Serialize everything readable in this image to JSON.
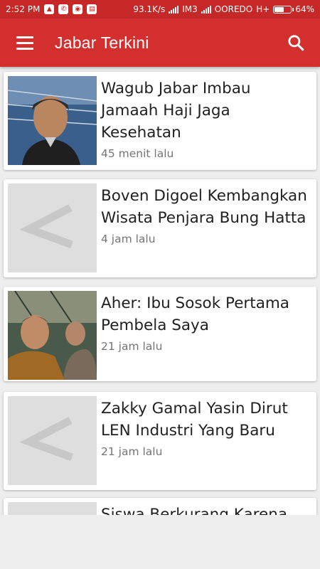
{
  "status_bar": {
    "time": "2:52 PM",
    "speed": "93.1K/s",
    "carrier1": "IM3",
    "carrier2": "OOREDO",
    "network": "H+",
    "battery": "64%",
    "battery_level": 0.64
  },
  "app_bar": {
    "title": "Jabar Terkini",
    "menu_icon": "hamburger-menu-icon",
    "search_icon": "search-icon"
  },
  "articles": [
    {
      "title": "Wagub Jabar Imbau Jamaah Haji Jaga Kesehatan",
      "time": "45 menit lalu",
      "thumbnail": "photo"
    },
    {
      "title": "Boven Digoel Kembangkan Wisata Penjara Bung Hatta",
      "time": "4 jam lalu",
      "thumbnail": "placeholder"
    },
    {
      "title": "Aher: Ibu Sosok Pertama Pembela Saya",
      "time": "21 jam lalu",
      "thumbnail": "photo"
    },
    {
      "title": "Zakky Gamal Yasin Dirut LEN Industri Yang Baru",
      "time": "21 jam lalu",
      "thumbnail": "placeholder"
    },
    {
      "title": "Siswa Berkurang Karena",
      "time": "",
      "thumbnail": "placeholder"
    }
  ],
  "colors": {
    "primary": "#d32f2f",
    "status_bar": "#c62828",
    "background": "#eeeeee"
  }
}
